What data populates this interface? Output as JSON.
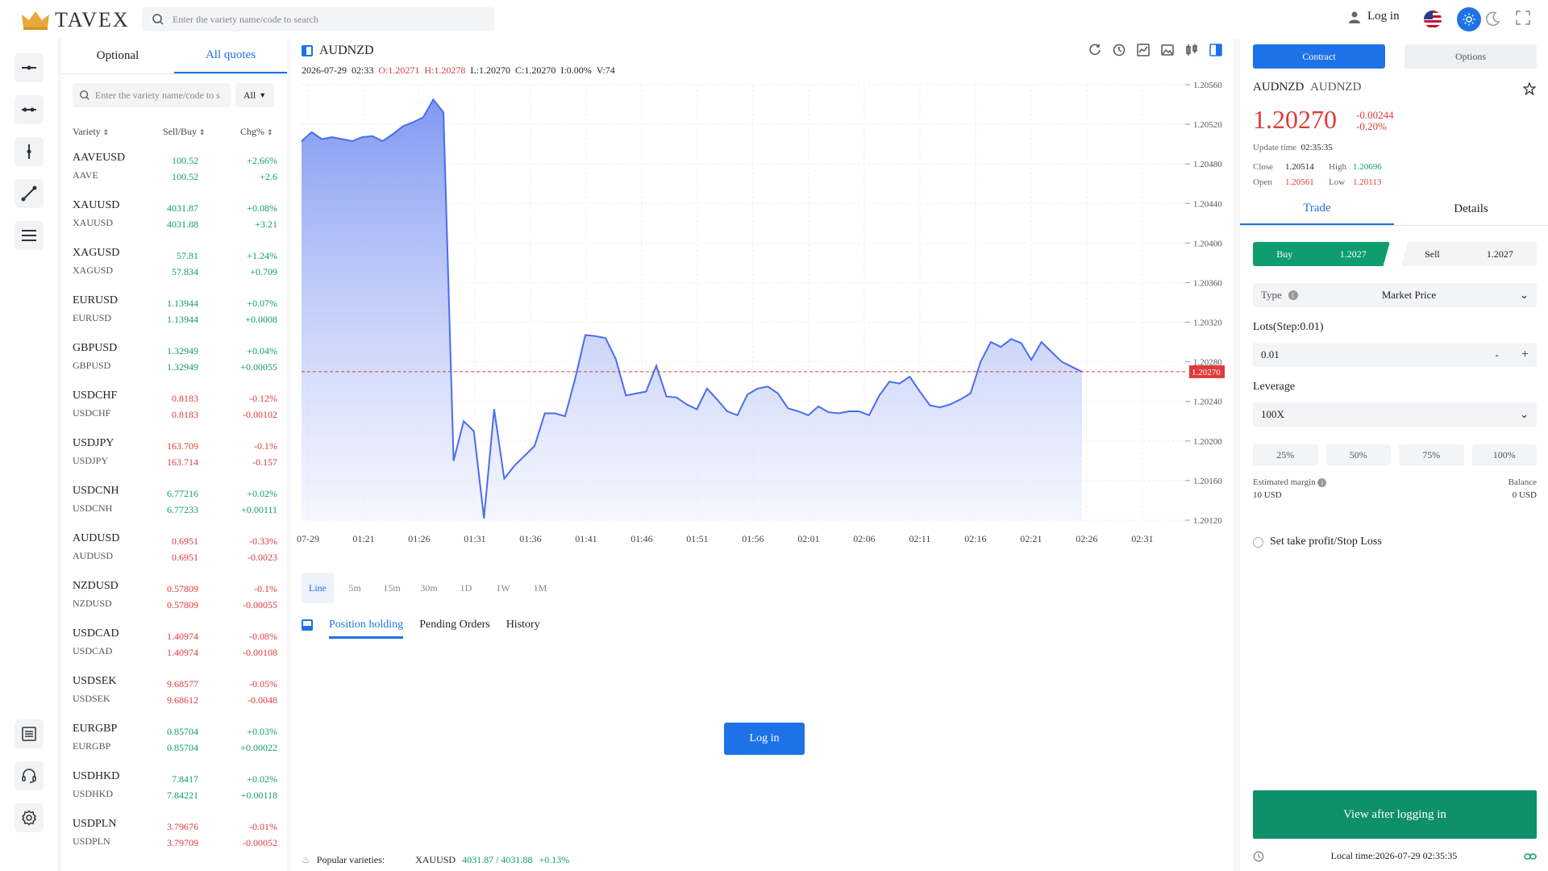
{
  "header": {
    "brand": "TAVEX",
    "search_placeholder": "Enter the variety name/code to search",
    "login": "Log in"
  },
  "quotes": {
    "tabs": [
      "Optional",
      "All quotes"
    ],
    "search_placeholder": "Enter the variety name/code to s",
    "filter": "All",
    "columns": [
      "Variety",
      "Sell/Buy",
      "Chg%"
    ],
    "rows": [
      {
        "name": "AAVEUSD",
        "sub": "AAVE",
        "sell": "100.52",
        "buy": "100.52",
        "pct": "+2.66%",
        "chg": "+2.6",
        "dir": "up"
      },
      {
        "name": "XAUUSD",
        "sub": "XAUUSD",
        "sell": "4031.87",
        "buy": "4031.88",
        "pct": "+0.08%",
        "chg": "+3.21",
        "dir": "up"
      },
      {
        "name": "XAGUSD",
        "sub": "XAGUSD",
        "sell": "57.81",
        "buy": "57.834",
        "pct": "+1.24%",
        "chg": "+0.709",
        "dir": "up"
      },
      {
        "name": "EURUSD",
        "sub": "EURUSD",
        "sell": "1.13944",
        "buy": "1.13944",
        "pct": "+0.07%",
        "chg": "+0.0008",
        "dir": "up"
      },
      {
        "name": "GBPUSD",
        "sub": "GBPUSD",
        "sell": "1.32949",
        "buy": "1.32949",
        "pct": "+0.04%",
        "chg": "+0.00055",
        "dir": "up"
      },
      {
        "name": "USDCHF",
        "sub": "USDCHF",
        "sell": "0.8183",
        "buy": "0.8183",
        "pct": "-0.12%",
        "chg": "-0.00102",
        "dir": "dn"
      },
      {
        "name": "USDJPY",
        "sub": "USDJPY",
        "sell": "163.709",
        "buy": "163.714",
        "pct": "-0.1%",
        "chg": "-0.157",
        "dir": "dn"
      },
      {
        "name": "USDCNH",
        "sub": "USDCNH",
        "sell": "6.77216",
        "buy": "6.77233",
        "pct": "+0.02%",
        "chg": "+0.00111",
        "dir": "up"
      },
      {
        "name": "AUDUSD",
        "sub": "AUDUSD",
        "sell": "0.6951",
        "buy": "0.6951",
        "pct": "-0.33%",
        "chg": "-0.0023",
        "dir": "dn"
      },
      {
        "name": "NZDUSD",
        "sub": "NZDUSD",
        "sell": "0.57809",
        "buy": "0.57809",
        "pct": "-0.1%",
        "chg": "-0.00055",
        "dir": "dn"
      },
      {
        "name": "USDCAD",
        "sub": "USDCAD",
        "sell": "1.40974",
        "buy": "1.40974",
        "pct": "-0.08%",
        "chg": "-0.00108",
        "dir": "dn"
      },
      {
        "name": "USDSEK",
        "sub": "USDSEK",
        "sell": "9.68577",
        "buy": "9.68612",
        "pct": "-0.05%",
        "chg": "-0.0048",
        "dir": "dn"
      },
      {
        "name": "EURGBP",
        "sub": "EURGBP",
        "sell": "0.85704",
        "buy": "0.85704",
        "pct": "+0.03%",
        "chg": "+0.00022",
        "dir": "up"
      },
      {
        "name": "USDHKD",
        "sub": "USDHKD",
        "sell": "7.8417",
        "buy": "7.84221",
        "pct": "+0.02%",
        "chg": "+0.00118",
        "dir": "up"
      },
      {
        "name": "USDPLN",
        "sub": "USDPLN",
        "sell": "3.79676",
        "buy": "3.79709",
        "pct": "-0.01%",
        "chg": "-0.00052",
        "dir": "dn"
      }
    ]
  },
  "chart_panel": {
    "symbol": "AUDNZD",
    "date": "2026-07-29",
    "time": "02:33",
    "open": "O:1.20271",
    "high": "H:1.20278",
    "low": "L:1.20270",
    "close": "C:1.20270",
    "ind": "I:0.00%",
    "vol": "V:74",
    "last_price_label": "1.20270",
    "periods": [
      "Line",
      "5m",
      "15m",
      "30m",
      "1D",
      "1W",
      "1M"
    ],
    "bottom_tabs": [
      "Position holding",
      "Pending Orders",
      "History"
    ],
    "login_button": "Log in",
    "popular_label": "Popular varieties:",
    "popular_symbol": "XAUUSD",
    "popular_price": "4031.87 / 4031.88",
    "popular_change": "+0.13%"
  },
  "chart_data": {
    "type": "area",
    "x": [
      "07-29",
      "01:21",
      "01:26",
      "01:31",
      "01:36",
      "01:41",
      "01:46",
      "01:51",
      "01:56",
      "02:01",
      "02:06",
      "02:11",
      "02:16",
      "02:21",
      "02:26",
      "02:31"
    ],
    "y_ticks": [
      "1.20560",
      "1.20520",
      "1.20480",
      "1.20440",
      "1.20400",
      "1.20360",
      "1.20320",
      "1.20280",
      "1.20240",
      "1.20200",
      "1.20160",
      "1.20120"
    ],
    "ylim": [
      1.2012,
      1.2056
    ],
    "last_price": 1.2027,
    "values": [
      1.20503,
      1.20512,
      1.20505,
      1.20507,
      1.20505,
      1.20503,
      1.20507,
      1.20508,
      1.20503,
      1.2051,
      1.20518,
      1.20522,
      1.20527,
      1.20545,
      1.20532,
      1.2018,
      1.2022,
      1.2021,
      1.20122,
      1.20232,
      1.20162,
      1.20175,
      1.20185,
      1.20195,
      1.20228,
      1.20228,
      1.20225,
      1.20263,
      1.20307,
      1.20306,
      1.20304,
      1.20283,
      1.20246,
      1.20248,
      1.2025,
      1.20276,
      1.20245,
      1.20244,
      1.20237,
      1.20232,
      1.20253,
      1.20242,
      1.2023,
      1.20226,
      1.20247,
      1.20253,
      1.20255,
      1.20248,
      1.20233,
      1.2023,
      1.20226,
      1.20235,
      1.20229,
      1.20228,
      1.2023,
      1.2023,
      1.20226,
      1.20246,
      1.2026,
      1.20258,
      1.20265,
      1.2025,
      1.20236,
      1.20234,
      1.20237,
      1.20242,
      1.20248,
      1.2028,
      1.203,
      1.20295,
      1.20303,
      1.20299,
      1.20282,
      1.203,
      1.2029,
      1.2028,
      1.20275,
      1.2027
    ]
  },
  "trade": {
    "top_buttons": [
      "Contract",
      "Options"
    ],
    "symbol": "AUDNZD",
    "symbol_sub": "AUDNZD",
    "price": "1.20270",
    "change": "-0.00244",
    "change_pct": "-0.20%",
    "update_label": "Update time",
    "update_time": "02:35:35",
    "close_label": "Close",
    "close": "1.20514",
    "high_label": "High",
    "high": "1.20696",
    "open_label": "Open",
    "open": "1.20561",
    "low_label": "Low",
    "low": "1.20113",
    "tabs": [
      "Trade",
      "Details"
    ],
    "buy_label": "Buy",
    "buy_price": "1.2027",
    "sell_label": "Sell",
    "sell_price": "1.2027",
    "type_label": "Type",
    "type_value": "Market Price",
    "lots_label": "Lots(Step:0.01)",
    "lots_value": "0.01",
    "leverage_label": "Leverage",
    "leverage_value": "100X",
    "percents": [
      "25%",
      "50%",
      "75%",
      "100%"
    ],
    "margin_label": "Estimated margin",
    "margin_value": "10 USD",
    "balance_label": "Balance",
    "balance_value": "0 USD",
    "tpsl_label": "Set take profit/Stop Loss",
    "view_button": "View after logging in",
    "local_time": "Local time:2026-07-29 02:35:35"
  },
  "colors": {
    "accent": "#1e72e8",
    "up": "#0f9d6f",
    "down": "#e03a3a"
  }
}
